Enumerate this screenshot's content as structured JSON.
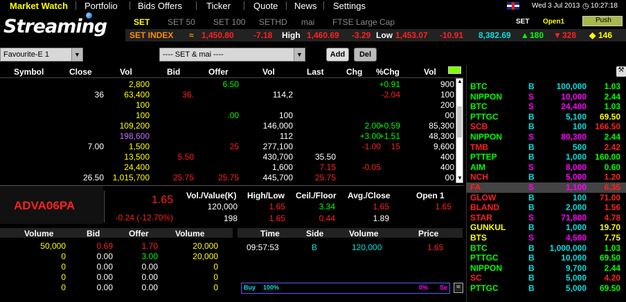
{
  "menu": {
    "items": [
      "Market Watch",
      "Portfolio",
      "Bids Offers",
      "Ticker",
      "Quote",
      "News",
      "Settings"
    ]
  },
  "status": {
    "market": "SET",
    "date": "Wed 3 Jul 2013",
    "time": "10:27:18",
    "session": "Open1",
    "push": "Push"
  },
  "logo": "Streaming",
  "market_tabs": [
    "SET",
    "SET 50",
    "SET 100",
    "SETHD",
    "mai",
    "FTSE Large Cap"
  ],
  "index": {
    "name": "SET INDEX",
    "last": "1,450.80",
    "chg": "-7.18",
    "high_label": "High",
    "high": "1,460.69",
    "high_chg": "-3.29",
    "low_label": "Low",
    "low": "1,453.07",
    "low_chg": "-10.91",
    "value": "8,382.69",
    "up": "180",
    "down": "328",
    "unch": "146"
  },
  "filter": {
    "favourite": "Favourite-E 1",
    "market": "---- SET & mai ----",
    "add": "Add",
    "del": "Del"
  },
  "table": {
    "headers": [
      "Symbol",
      "Close",
      "Vol",
      "Bid",
      "Offer",
      "Vol",
      "Last",
      "Chg",
      "%Chg",
      "Vol"
    ],
    "rows": [
      {
        "close": "",
        "vol": "2,800",
        "bid": "",
        "offer": "6.50",
        "vol2": "",
        "last": "",
        "chg": "",
        "pchg": "+0.91",
        "tvol": "900"
      },
      {
        "close": "36",
        "vol": "63,400",
        "bid": "36.",
        "offer": "",
        "vol2": "114,2",
        "last": "",
        "chg": "",
        "pchg": "-2.04",
        "tvol": "100"
      },
      {
        "close": "",
        "vol": "100",
        "bid": "",
        "offer": "",
        "vol2": "",
        "last": "",
        "chg": "",
        "pchg": "",
        "tvol": "200"
      },
      {
        "close": "",
        "vol": "100",
        "bid": "",
        "offer": ".00",
        "vol2": "100",
        "last": "",
        "chg": "",
        "pchg": "",
        "tvol": "00"
      },
      {
        "close": "",
        "vol": "109,200",
        "bid": "",
        "offer": "",
        "vol2": "146,000",
        "last": "",
        "chg": "2.00",
        "pchg": "+0.59",
        "tvol": "85,300"
      },
      {
        "close": "",
        "vol": "198,600",
        "bid": "",
        "offer": "",
        "vol2": "112",
        "last": "",
        "chg": "+3.00",
        "pchg": "+1.51",
        "tvol": "48,300"
      },
      {
        "close": "7.00",
        "vol": "1,500",
        "bid": "",
        "offer": "25",
        "vol2": "277,100",
        "last": "",
        "chg": "-1.00",
        "pchg": "15",
        "tvol": "9,600"
      },
      {
        "close": "",
        "vol": "13,500",
        "bid": "5.50",
        "offer": "",
        "vol2": "430,700",
        "last": "35.50",
        "chg": "",
        "pchg": "",
        "tvol": "400"
      },
      {
        "close": "",
        "vol": "24,400",
        "bid": "",
        "offer": "",
        "vol2": "1,600",
        "last": "7.15",
        "chg": "-0.05",
        "pchg": "",
        "tvol": "400"
      },
      {
        "close": "26.50",
        "vol": "1,015,700",
        "bid": "25.75",
        "offer": "25.75",
        "vol2": "445,700",
        "last": "25.75",
        "chg": "",
        "pchg": "",
        "tvol": "00"
      }
    ]
  },
  "quote": {
    "symbol": "ADVA06PA",
    "last": "1.65",
    "change": "-0.24 (-12.70%)",
    "vol_label": "Vol./Value(K)",
    "vol": "120,000",
    "value": "198",
    "hl_label": "High/Low",
    "high": "1.65",
    "low": "1.65",
    "cf_label": "Ceil./Floor",
    "ceil": "3.34",
    "floor": "0.44",
    "ac_label": "Avg./Close",
    "avg": "1.65",
    "close": "1.89",
    "session": "Open 1",
    "session_price": "1.65"
  },
  "book": {
    "headers": [
      "Volume",
      "Bid",
      "Offer",
      "Volume"
    ],
    "rows": [
      [
        "50,000",
        "0.69",
        "1.70",
        "20,000"
      ],
      [
        "0",
        "0.00",
        "3.00",
        "20,000"
      ],
      [
        "0",
        "0.00",
        "0.00",
        "0"
      ],
      [
        "0",
        "0.00",
        "0.00",
        "0"
      ],
      [
        "0",
        "0.00",
        "0.00",
        "0"
      ]
    ]
  },
  "trades": {
    "headers": [
      "Time",
      "Side",
      "Volume",
      "Price"
    ],
    "rows": [
      [
        "09:57:53",
        "B",
        "120,000",
        "1.65"
      ]
    ]
  },
  "buysell": {
    "buy": "Buy",
    "buy_pct": "100%",
    "sell_pct": "0%",
    "sell": "Se"
  },
  "ticker": [
    [
      "BTC",
      "B",
      "100,000",
      "1.03"
    ],
    [
      "NIPPON",
      "S",
      "10,000",
      "2.44"
    ],
    [
      "BTC",
      "S",
      "24,400",
      "1.03"
    ],
    [
      "PTTGC",
      "B",
      "5,100",
      "69.50"
    ],
    [
      "SCB",
      "B",
      "100",
      "166.50"
    ],
    [
      "NIPPON",
      "S",
      "80,300",
      "2.44"
    ],
    [
      "TMB",
      "B",
      "500",
      "2.42"
    ],
    [
      "PTTEP",
      "B",
      "1,000",
      "160.00"
    ],
    [
      "AIM",
      "S",
      "8,000",
      "0.60"
    ],
    [
      "NCH",
      "B",
      "5,000",
      "1.20"
    ],
    [
      "FA",
      "S",
      "1,100",
      "6.35"
    ],
    [
      "GLOW",
      "B",
      "100",
      "71.00"
    ],
    [
      "BLAND",
      "B",
      "2,000",
      "1.56"
    ],
    [
      "STAR",
      "S",
      "71,800",
      "4.78"
    ],
    [
      "GUNKUL",
      "B",
      "1,000",
      "19.70"
    ],
    [
      "BTS",
      "S",
      "4,500",
      "7.75"
    ],
    [
      "BTC",
      "B",
      "1,000,000",
      "1.03"
    ],
    [
      "PTTGC",
      "B",
      "10,000",
      "69.50"
    ],
    [
      "NIPPON",
      "B",
      "9,700",
      "2.44"
    ],
    [
      "SC",
      "B",
      "5,000",
      "4.20"
    ],
    [
      "PTTGC",
      "B",
      "5,000",
      "69.50"
    ]
  ],
  "colors": {
    "up": "#00ff00",
    "down": "#ff2020",
    "buy": "#00e0e0",
    "sell": "#ff00ff",
    "header": "#ffff00"
  }
}
